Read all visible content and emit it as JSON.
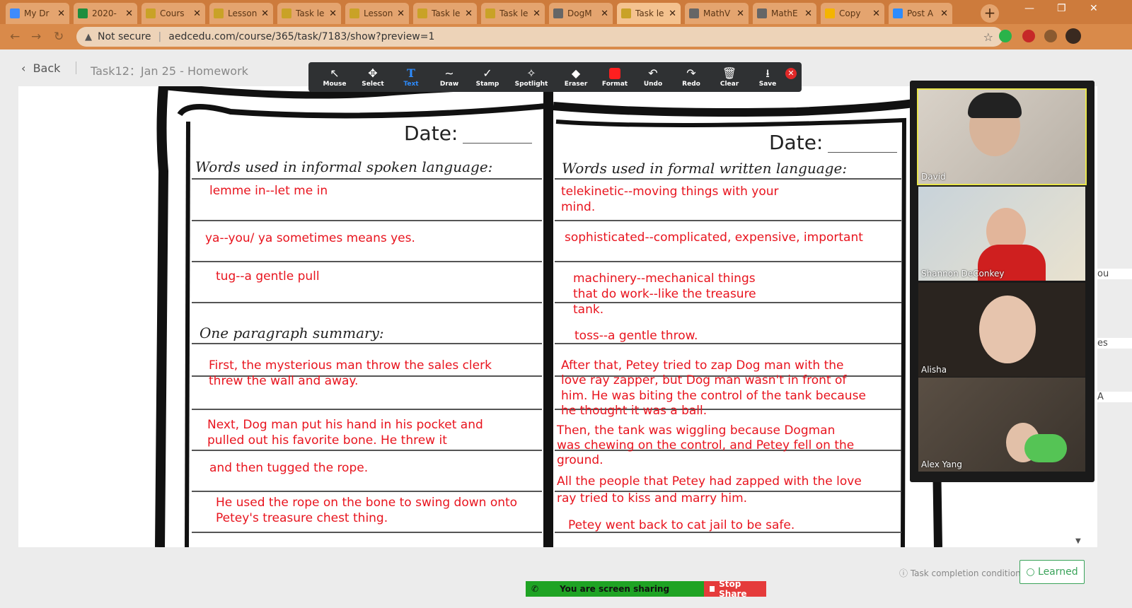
{
  "browser": {
    "tabs": [
      {
        "label": "My Dr",
        "fav": "#3d8bfd"
      },
      {
        "label": "2020-",
        "fav": "#1e8e3e"
      },
      {
        "label": "Cours",
        "fav": "#c9a227"
      },
      {
        "label": "Lesson",
        "fav": "#c9a227"
      },
      {
        "label": "Task le",
        "fav": "#c9a227"
      },
      {
        "label": "Lesson",
        "fav": "#c9a227"
      },
      {
        "label": "Task le",
        "fav": "#c9a227"
      },
      {
        "label": "Task le",
        "fav": "#c9a227"
      },
      {
        "label": "DogM",
        "fav": "#666666"
      },
      {
        "label": "Task le",
        "fav": "#c9a227"
      },
      {
        "label": "MathV",
        "fav": "#666666"
      },
      {
        "label": "MathE",
        "fav": "#666666"
      },
      {
        "label": "Copy",
        "fav": "#f4b400"
      },
      {
        "label": "Post A",
        "fav": "#2d8cff"
      }
    ],
    "security_label": "Not secure",
    "url": "aedcedu.com/course/365/task/7183/show?preview=1"
  },
  "page": {
    "back_label": "Back",
    "task_title": "Task12：Jan 25 - Homework"
  },
  "toolbar": {
    "tools": [
      "Mouse",
      "Select",
      "Text",
      "Draw",
      "Stamp",
      "Spotlight",
      "Eraser",
      "Format",
      "Undo",
      "Redo",
      "Clear",
      "Save"
    ],
    "active": "Text"
  },
  "worksheet": {
    "left": {
      "date": "Date:",
      "heading": "Words used in informal spoken language:",
      "summary_heading": "One paragraph summary:",
      "entries": [
        "lemme in--let me in",
        "ya--you/  ya sometimes means yes.",
        "tug--a gentle pull"
      ],
      "summary": [
        "First, the mysterious man throw the sales clerk",
        "threw the wall and away.",
        "Next, Dog man put his hand in his pocket and",
        "pulled out his favorite bone.        He threw it",
        "and then tugged the rope.",
        "He used the rope on the bone to swing down onto",
        "Petey's treasure chest thing."
      ]
    },
    "right": {
      "date": "Date:",
      "heading": "Words used in formal written language:",
      "entries": [
        "telekinetic--moving things with your",
        "mind.",
        "sophisticated--complicated, expensive, important",
        "machinery--mechanical things",
        "that do work--like the treasure",
        "tank.",
        "toss--a gentle throw."
      ],
      "summary": [
        "After that, Petey tried to zap Dog man with the",
        "love ray zapper, but Dog man wasn't in front of",
        "him. He was biting the control of the tank because",
        "he thought it was a ball.",
        "Then, the tank was wiggling because Dogman",
        "was chewing on the control, and Petey fell on the",
        "ground.",
        "All the people that Petey had zapped with the love",
        "ray  tried to kiss and marry him.",
        "Petey went back to cat jail to be safe."
      ]
    }
  },
  "participants": [
    "David",
    "Shannon DeConkey",
    "Alisha",
    "Alex Yang"
  ],
  "side_fragments": [
    "ou",
    "es",
    "A"
  ],
  "footer": {
    "completion_label": "Task completion condition",
    "learned_label": "Learned",
    "sharing_label": "You are screen sharing",
    "stop_label": "Stop Share"
  }
}
